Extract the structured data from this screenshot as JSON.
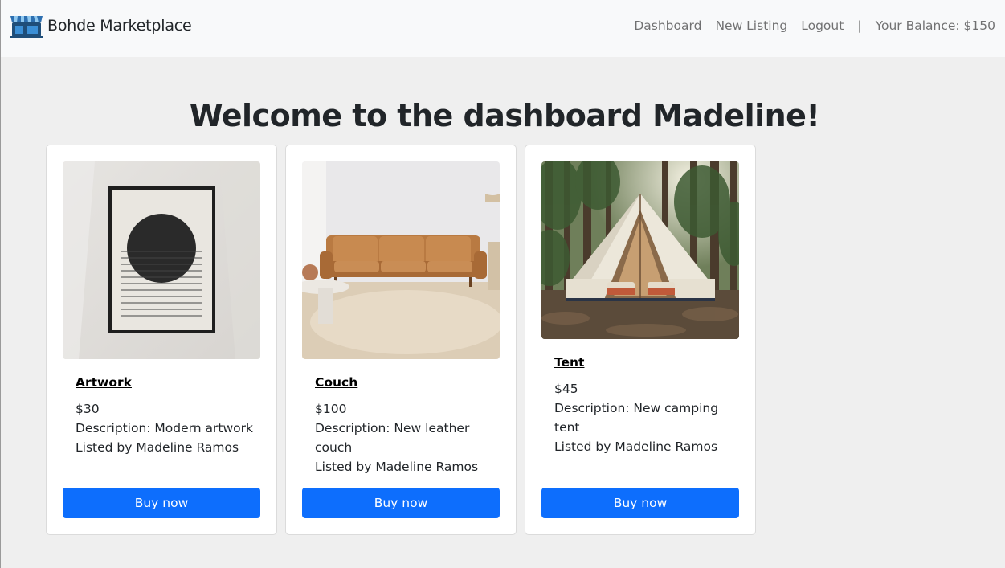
{
  "navbar": {
    "brand": "Bohde Marketplace",
    "links": {
      "dashboard": "Dashboard",
      "new_listing": "New Listing",
      "logout": "Logout"
    },
    "separator": "|",
    "balance": "Your Balance: $150"
  },
  "welcome": "Welcome to the dashboard Madeline!",
  "listings": [
    {
      "name": "Artwork",
      "price": "$30",
      "description": "Description: Modern artwork",
      "listed_by": "Listed by Madeline Ramos",
      "buy_label": "Buy now",
      "image": "framed-circle-artwork-image"
    },
    {
      "name": "Couch",
      "price": "$100",
      "description": "Description: New leather couch",
      "listed_by": "Listed by Madeline Ramos",
      "buy_label": "Buy now",
      "image": "leather-couch-image"
    },
    {
      "name": "Tent",
      "price": "$45",
      "description": "Description: New camping tent",
      "listed_by": "Listed by Madeline Ramos",
      "buy_label": "Buy now",
      "image": "bell-tent-forest-image"
    }
  ],
  "colors": {
    "primary": "#0d6efd",
    "navbar_bg": "#f8f9fa",
    "page_bg": "#efefef"
  }
}
